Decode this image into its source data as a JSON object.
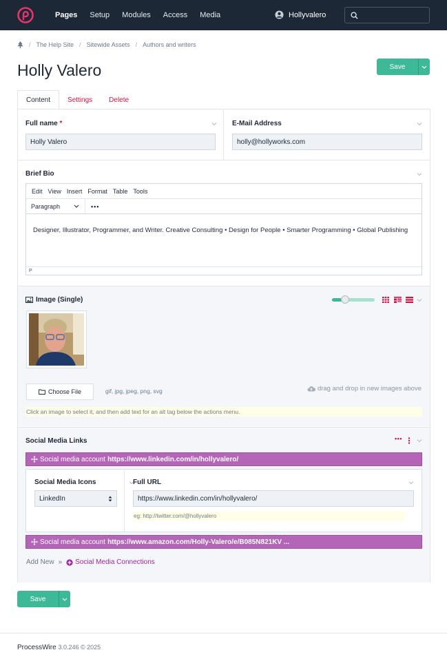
{
  "nav": {
    "items": [
      "Pages",
      "Setup",
      "Modules",
      "Access",
      "Media"
    ],
    "active": "Pages",
    "user": "Hollyvalero"
  },
  "breadcrumbs": [
    "The Help Site",
    "Sitewide Assets",
    "Authors and writers"
  ],
  "page": {
    "title": "Holly Valero",
    "save_label": "Save"
  },
  "tabs": [
    "Content",
    "Settings",
    "Delete"
  ],
  "fields": {
    "full_name": {
      "label": "Full name",
      "required_mark": "*",
      "value": "Holly Valero"
    },
    "email": {
      "label": "E-Mail Address",
      "value": "holly@hollyworks.com"
    },
    "bio": {
      "label": "Brief Bio",
      "menu": [
        "Edit",
        "View",
        "Insert",
        "Format",
        "Table",
        "Tools"
      ],
      "block_format": "Paragraph",
      "more": "•••",
      "text": "Designer, Illustrator, Programmer, and Writer. Creative Consulting • Design for People • Smarter Programming • Global Publishing",
      "status": "P"
    },
    "image": {
      "label": "Image (Single)",
      "choose_file": "Choose File",
      "extensions": "gif, jpg, jpeg, png, svg",
      "drop_hint": "drag and drop in new images above",
      "notes": "Click an image to select it, and then add text for an alt tag below the actions menu.",
      "zoom_percent": 30
    },
    "social": {
      "label": "Social Media Links",
      "more": "•••",
      "items": [
        {
          "prefix": "Social media account",
          "url": "https://www.linkedin.com/in/hollyvalero/"
        },
        {
          "prefix": "Social media account",
          "url": "https://www.amazon.com/Holly-Valero/e/B085N821KV ..."
        }
      ],
      "icons_label": "Social Media Icons",
      "icons_value": "LinkedIn",
      "url_label": "Full URL",
      "url_value": "https://www.linkedin.com/in/hollyvalero/",
      "url_hint": "eg: http://twitter.com/@hollyvalero",
      "add_new": "Add New",
      "add_sep": "»",
      "add_link": "Social Media Connections"
    }
  },
  "footer": {
    "brand": "ProcessWire",
    "version": "3.0.246 © 2025"
  },
  "colors": {
    "accent": "#3eb998",
    "danger": "#d2133f",
    "topbar": "#1c2836",
    "repeater": "#b465b8"
  }
}
